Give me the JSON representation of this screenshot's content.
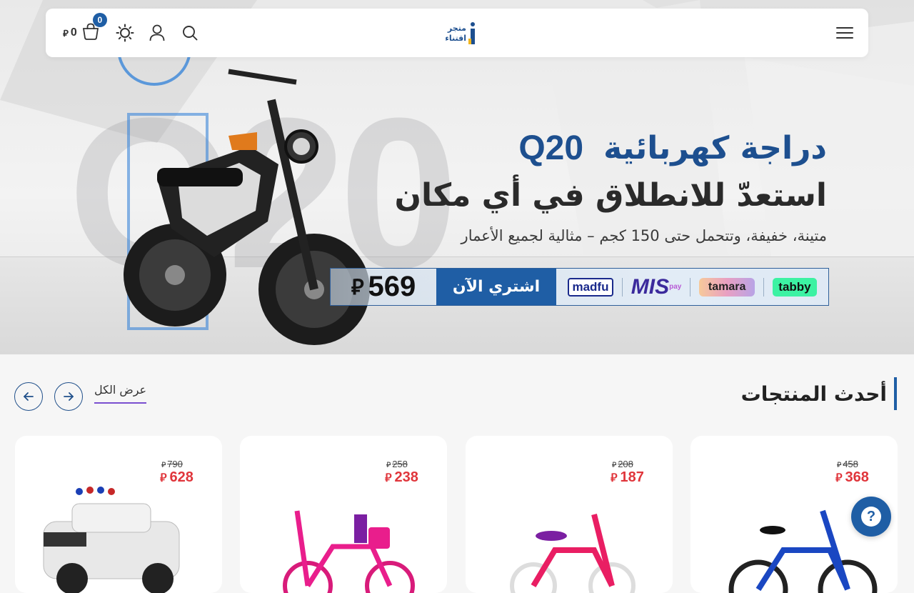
{
  "header": {
    "cart_total": "0",
    "cart_count": "0",
    "currency_symbol": "⃁",
    "logo_line1": "متجر",
    "logo_line2": "اقتناء",
    "icons": [
      "cart-icon",
      "sun-icon",
      "user-icon",
      "search-icon",
      "menu-icon"
    ]
  },
  "hero": {
    "watermark": "Q20",
    "title": "دراجة كهربائية",
    "model": "Q20",
    "subtitle": "استعدّ للانطلاق في أي مكان",
    "description": "متينة، خفيفة، وتتحمل حتى 150 كجم – مثالية لجميع الأعمار",
    "price": "569",
    "buy_label": "اشتري الآن",
    "payment_methods": {
      "madfu": "madfu",
      "mis": "MIS",
      "mis_sup": "pay",
      "tamara": "tamara",
      "tabby": "tabby"
    }
  },
  "section": {
    "title": "أحدث المنتجات",
    "view_all": "عرض الكل"
  },
  "products": [
    {
      "old_price": "790",
      "new_price": "628",
      "image": "police-ride-on-car"
    },
    {
      "old_price": "258",
      "new_price": "238",
      "image": "pink-kids-bike-basket"
    },
    {
      "old_price": "208",
      "new_price": "187",
      "image": "pink-kids-bike"
    },
    {
      "old_price": "458",
      "new_price": "368",
      "image": "blue-kids-bike"
    }
  ],
  "colors": {
    "brand_blue": "#1f5ea5",
    "sale_red": "#e0353b",
    "accent_purple": "#7a4fd0"
  },
  "help": {
    "label": "?"
  }
}
